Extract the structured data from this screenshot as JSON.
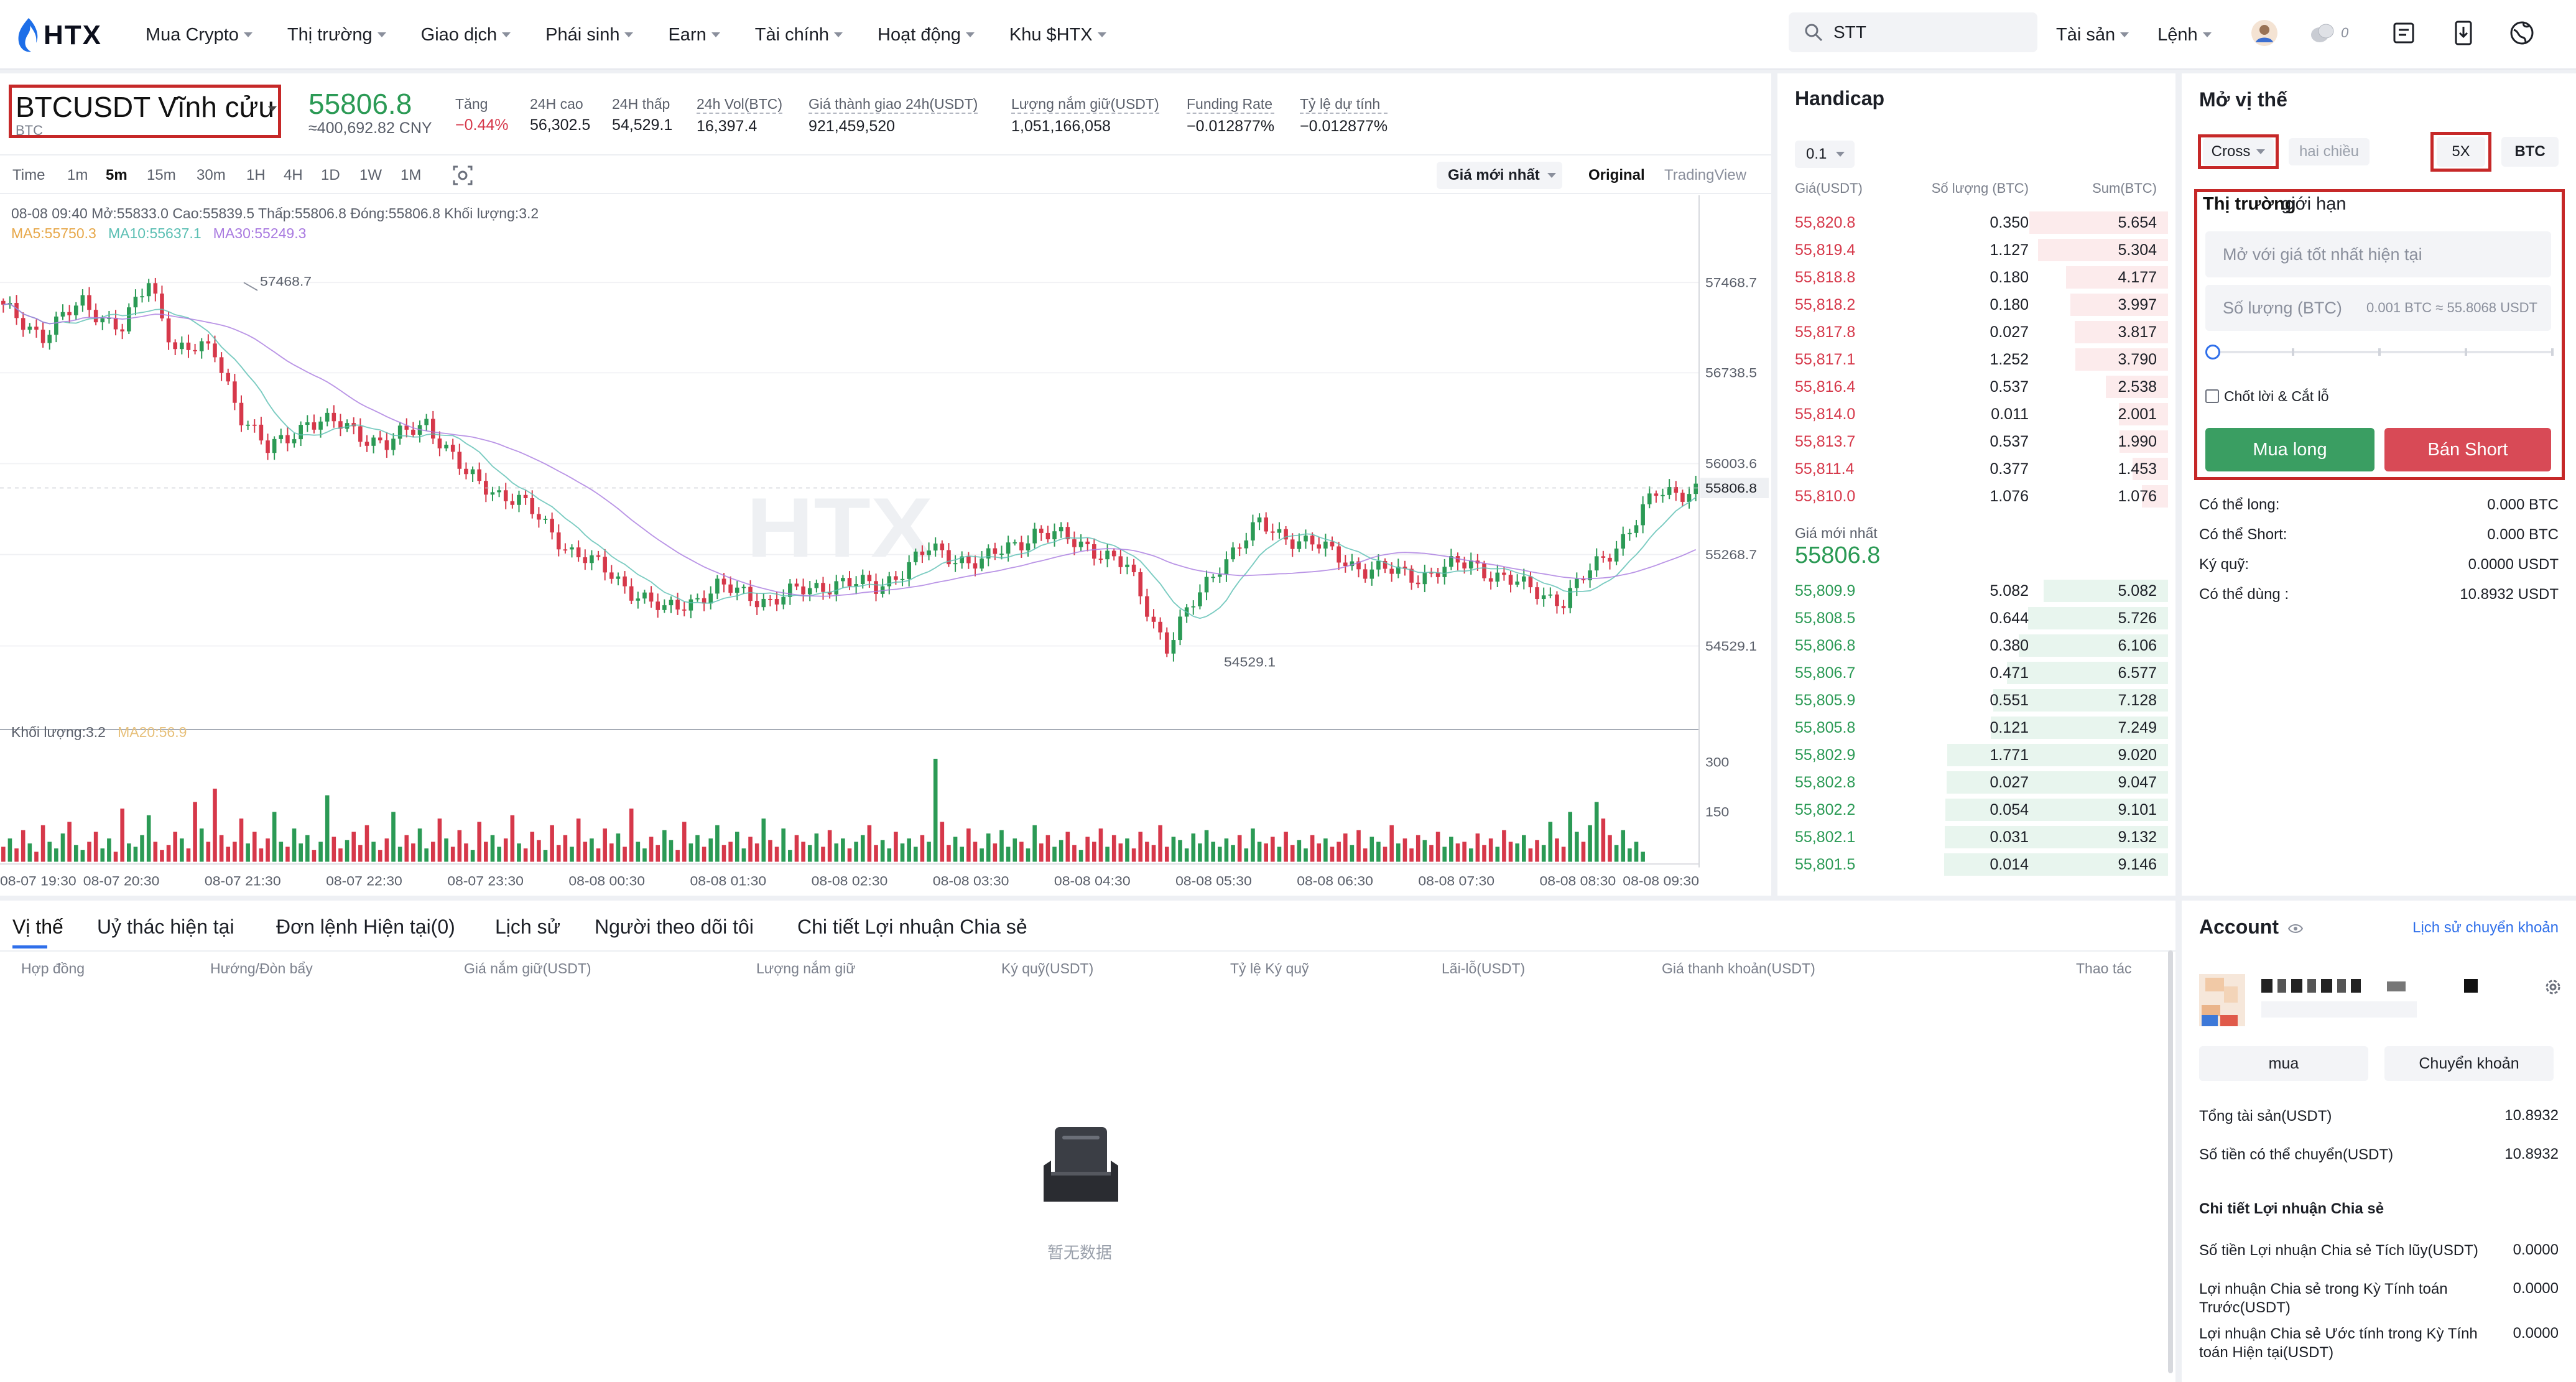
{
  "nav": {
    "logo": "HTX",
    "menu": [
      "Mua Crypto",
      "Thị trường",
      "Giao dịch",
      "Phái sinh",
      "Earn",
      "Tài chính",
      "Hoạt động",
      "Khu $HTX"
    ],
    "search_value": "STT",
    "right": [
      "Tài sản",
      "Lệnh"
    ],
    "notif_count": "0"
  },
  "symbol": {
    "name": "BTCUSDT Vĩnh cửu",
    "sub": "BTC",
    "last_price": "55806.8",
    "last_cny": "≈400,692.82 CNY"
  },
  "stats": [
    {
      "label": "Tăng",
      "value": "−0.44%",
      "red": true,
      "underline": false
    },
    {
      "label": "24H cao",
      "value": "56,302.5",
      "red": false,
      "underline": false
    },
    {
      "label": "24H thấp",
      "value": "54,529.1",
      "red": false,
      "underline": false
    },
    {
      "label": "24h Vol(BTC)",
      "value": "16,397.4",
      "red": false,
      "underline": true
    },
    {
      "label": "Giá thành giao 24h(USDT)",
      "value": "921,459,520",
      "red": false,
      "underline": true
    },
    {
      "label": "Lượng nắm giữ(USDT)",
      "value": "1,051,166,058",
      "red": false,
      "underline": true
    },
    {
      "label": "Funding Rate",
      "value": "−0.012877%",
      "red": false,
      "underline": true
    },
    {
      "label": "Tỷ lệ dự tính",
      "value": "−0.012877%",
      "red": false,
      "underline": true
    }
  ],
  "timeframes": [
    "Time",
    "1m",
    "5m",
    "15m",
    "30m",
    "1H",
    "4H",
    "1D",
    "1W",
    "1M"
  ],
  "active_timeframe": "5m",
  "chart_toolbar": {
    "price_mode": "Giá mới nhất",
    "view_original": "Original",
    "view_tv": "TradingView"
  },
  "chart_header": {
    "ohlc": "08-08 09:40  Mở:55833.0  Cao:55839.5  Thấp:55806.8  Đóng:55806.8  Khối lượng:3.2",
    "ma5": "MA5:55750.3",
    "ma10": "MA10:55637.1",
    "ma30": "MA30:55249.3",
    "vol": "Khối lượng:3.2",
    "vol_ma20": "MA20:56.9",
    "watermark": "HTX"
  },
  "chart_data": {
    "type": "candlestick",
    "x_labels": [
      "08-07 19:30",
      "08-07 20:30",
      "08-07 21:30",
      "08-07 22:30",
      "08-07 23:30",
      "08-08 00:30",
      "08-08 01:30",
      "08-08 02:30",
      "08-08 03:30",
      "08-08 04:30",
      "08-08 05:30",
      "08-08 06:30",
      "08-08 07:30",
      "08-08 08:30",
      "08-08 09:30"
    ],
    "y_ticks": [
      "57468.7",
      "56738.5",
      "56003.6",
      "55268.7",
      "54529.1"
    ],
    "y_tick_values": [
      57468.7,
      56738.5,
      56003.6,
      55268.7,
      54529.1
    ],
    "current_price_label": "55806.8",
    "current_price": 55806.8,
    "high_label": "57468.7",
    "high": 57468.7,
    "low_label": "54529.1",
    "low": 54529.1,
    "ylim": [
      54200,
      57900
    ],
    "vol_ticks": [
      "300",
      "150"
    ],
    "vol_tick_values": [
      300,
      150
    ],
    "vol_ylim": [
      0,
      340
    ],
    "anchors": [
      [
        0,
        57250
      ],
      [
        6,
        57050
      ],
      [
        12,
        57300
      ],
      [
        18,
        57100
      ],
      [
        22,
        57468.7
      ],
      [
        26,
        56950
      ],
      [
        32,
        56900
      ],
      [
        36,
        56400
      ],
      [
        40,
        56100
      ],
      [
        46,
        56350
      ],
      [
        52,
        56300
      ],
      [
        58,
        56150
      ],
      [
        64,
        56350
      ],
      [
        70,
        55900
      ],
      [
        78,
        55700
      ],
      [
        86,
        55300
      ],
      [
        92,
        55100
      ],
      [
        100,
        54800
      ],
      [
        108,
        55000
      ],
      [
        116,
        54900
      ],
      [
        126,
        55050
      ],
      [
        132,
        55000
      ],
      [
        140,
        55300
      ],
      [
        148,
        55200
      ],
      [
        156,
        55450
      ],
      [
        164,
        55350
      ],
      [
        170,
        55150
      ],
      [
        176,
        54529.1
      ],
      [
        184,
        55200
      ],
      [
        190,
        55500
      ],
      [
        198,
        55350
      ],
      [
        206,
        55150
      ],
      [
        214,
        55100
      ],
      [
        222,
        55200
      ],
      [
        230,
        55000
      ],
      [
        236,
        54900
      ],
      [
        244,
        55350
      ],
      [
        250,
        55750
      ],
      [
        256,
        55806.8
      ]
    ],
    "volumes": [
      45,
      70,
      40,
      95,
      55,
      30,
      110,
      60,
      40,
      85,
      120,
      50,
      35,
      60,
      90,
      40,
      70,
      30,
      160,
      55,
      45,
      80,
      140,
      60,
      35,
      50,
      90,
      70,
      40,
      180,
      100,
      60,
      220,
      80,
      45,
      60,
      130,
      55,
      90,
      40,
      70,
      150,
      60,
      45,
      100,
      55,
      80,
      35,
      60,
      200,
      75,
      40,
      65,
      90,
      50,
      110,
      60,
      35,
      70,
      150,
      45,
      80,
      55,
      100,
      40,
      60,
      130,
      70,
      45,
      95,
      55,
      35,
      120,
      60,
      80,
      45,
      70,
      140,
      55,
      40,
      90,
      65,
      35,
      110,
      50,
      80,
      45,
      130,
      60,
      70,
      40,
      100,
      55,
      85,
      45,
      160,
      60,
      40,
      75,
      50,
      95,
      65,
      35,
      120,
      55,
      80,
      45,
      70,
      110,
      50,
      60,
      90,
      40,
      75,
      55,
      130,
      65,
      45,
      100,
      35,
      80,
      60,
      50,
      85,
      45,
      95,
      55,
      70,
      40,
      60,
      80,
      110,
      50,
      65,
      40,
      90,
      55,
      70,
      45,
      80,
      60,
      310,
      120,
      50,
      75,
      45,
      100,
      60,
      40,
      85,
      55,
      95,
      45,
      70,
      60,
      40,
      110,
      55,
      80,
      45,
      65,
      90,
      50,
      35,
      75,
      60,
      100,
      45,
      80,
      55,
      70,
      40,
      90,
      60,
      50,
      110,
      45,
      75,
      65,
      40,
      85,
      55,
      95,
      60,
      45,
      70,
      50,
      80,
      40,
      100,
      60,
      55,
      75,
      45,
      90,
      50,
      65,
      40,
      80,
      55,
      70,
      45,
      60,
      85,
      50,
      95,
      40,
      75,
      60,
      45,
      110,
      55,
      70,
      40,
      80,
      65,
      50,
      90,
      45,
      75,
      55,
      60,
      40,
      85,
      50,
      70,
      45,
      95,
      60,
      55,
      80,
      40,
      65,
      50,
      120,
      70,
      45,
      150,
      90,
      60,
      110,
      180,
      130,
      80,
      50,
      95,
      40,
      60,
      30
    ]
  },
  "orderbook": {
    "title": "Handicap",
    "precision": "0.1",
    "cols": [
      "Giá(USDT)",
      "Số lượng (BTC)",
      "Sum(BTC)"
    ],
    "asks": [
      [
        "55,820.8",
        "0.350",
        "5.654"
      ],
      [
        "55,819.4",
        "1.127",
        "5.304"
      ],
      [
        "55,818.8",
        "0.180",
        "4.177"
      ],
      [
        "55,818.2",
        "0.180",
        "3.997"
      ],
      [
        "55,817.8",
        "0.027",
        "3.817"
      ],
      [
        "55,817.1",
        "1.252",
        "3.790"
      ],
      [
        "55,816.4",
        "0.537",
        "2.538"
      ],
      [
        "55,814.0",
        "0.011",
        "2.001"
      ],
      [
        "55,813.7",
        "0.537",
        "1.990"
      ],
      [
        "55,811.4",
        "0.377",
        "1.453"
      ],
      [
        "55,810.0",
        "1.076",
        "1.076"
      ]
    ],
    "latest_label": "Giá mới nhất",
    "latest_price": "55806.8",
    "bids": [
      [
        "55,809.9",
        "5.082",
        "5.082"
      ],
      [
        "55,808.5",
        "0.644",
        "5.726"
      ],
      [
        "55,806.8",
        "0.380",
        "6.106"
      ],
      [
        "55,806.7",
        "0.471",
        "6.577"
      ],
      [
        "55,805.9",
        "0.551",
        "7.128"
      ],
      [
        "55,805.8",
        "0.121",
        "7.249"
      ],
      [
        "55,802.9",
        "1.771",
        "9.020"
      ],
      [
        "55,802.8",
        "0.027",
        "9.047"
      ],
      [
        "55,802.2",
        "0.054",
        "9.101"
      ],
      [
        "55,802.1",
        "0.031",
        "9.132"
      ],
      [
        "55,801.5",
        "0.014",
        "9.146"
      ]
    ]
  },
  "trade": {
    "title": "Mở vị thế",
    "margin_mode": "Cross",
    "position_mode": "hai chiều",
    "leverage": "5X",
    "unit": "BTC",
    "order_types": [
      "Thị trường",
      "giới hạn"
    ],
    "price_placeholder": "Mở với giá tốt nhất hiện tại",
    "qty_label": "Số lượng (BTC)",
    "qty_hint": "0.001 BTC ≈ 55.8068 USDT",
    "slider_value_pct": 0,
    "tpsl_label": "Chốt lời & Cắt lỗ",
    "buy_label": "Mua long",
    "sell_label": "Bán Short",
    "info": [
      [
        "Có thể long:",
        "0.000 BTC"
      ],
      [
        "Có thể Short:",
        "0.000 BTC"
      ],
      [
        "Ký quỹ:",
        "0.0000 USDT"
      ],
      [
        "Có thể dùng :",
        "10.8932 USDT"
      ]
    ]
  },
  "positions": {
    "tabs": [
      "Vị thế",
      "Uỷ thác hiện tại",
      "Đơn lệnh Hiện tại(0)",
      "Lịch sử",
      "Người theo dõi tôi",
      "Chi tiết Lợi nhuận Chia sẻ"
    ],
    "columns": [
      "Hợp đồng",
      "Hướng/Đòn bẩy",
      "Giá nắm giữ(USDT)",
      "Lượng nắm giữ",
      "Ký quỹ(USDT)",
      "Tỷ lệ Ký quỹ",
      "Lãi-lỗ(USDT)",
      "Giá thanh khoản(USDT)",
      "Thao tác"
    ],
    "empty_text": "暂无数据"
  },
  "account": {
    "title": "Account",
    "history_link": "Lịch sử chuyển khoản",
    "buy_button": "mua",
    "transfer_button": "Chuyển khoản",
    "rows": [
      [
        "Tổng tài sản(USDT)",
        "10.8932"
      ],
      [
        "Số tiền có thể chuyển(USDT)",
        "10.8932"
      ]
    ],
    "profit_title": "Chi tiết Lợi nhuận Chia sẻ",
    "profit_rows": [
      [
        "Số tiền Lợi nhuận Chia sẻ Tích lũy(USDT)",
        "0.0000"
      ],
      [
        "Lợi nhuận Chia sẻ trong Kỳ Tính toán Trước(USDT)",
        "0.0000"
      ],
      [
        "Lợi nhuận Chia sẻ Ước tính trong Kỳ Tính toán Hiện tại(USDT)",
        "0.0000"
      ]
    ]
  },
  "colors": {
    "up": "#2b9a55",
    "down": "#d6384a",
    "accent": "#2f6fea",
    "ma5": "#e7a84a",
    "ma10": "#5bbfb3",
    "ma30": "#a97ae0"
  }
}
